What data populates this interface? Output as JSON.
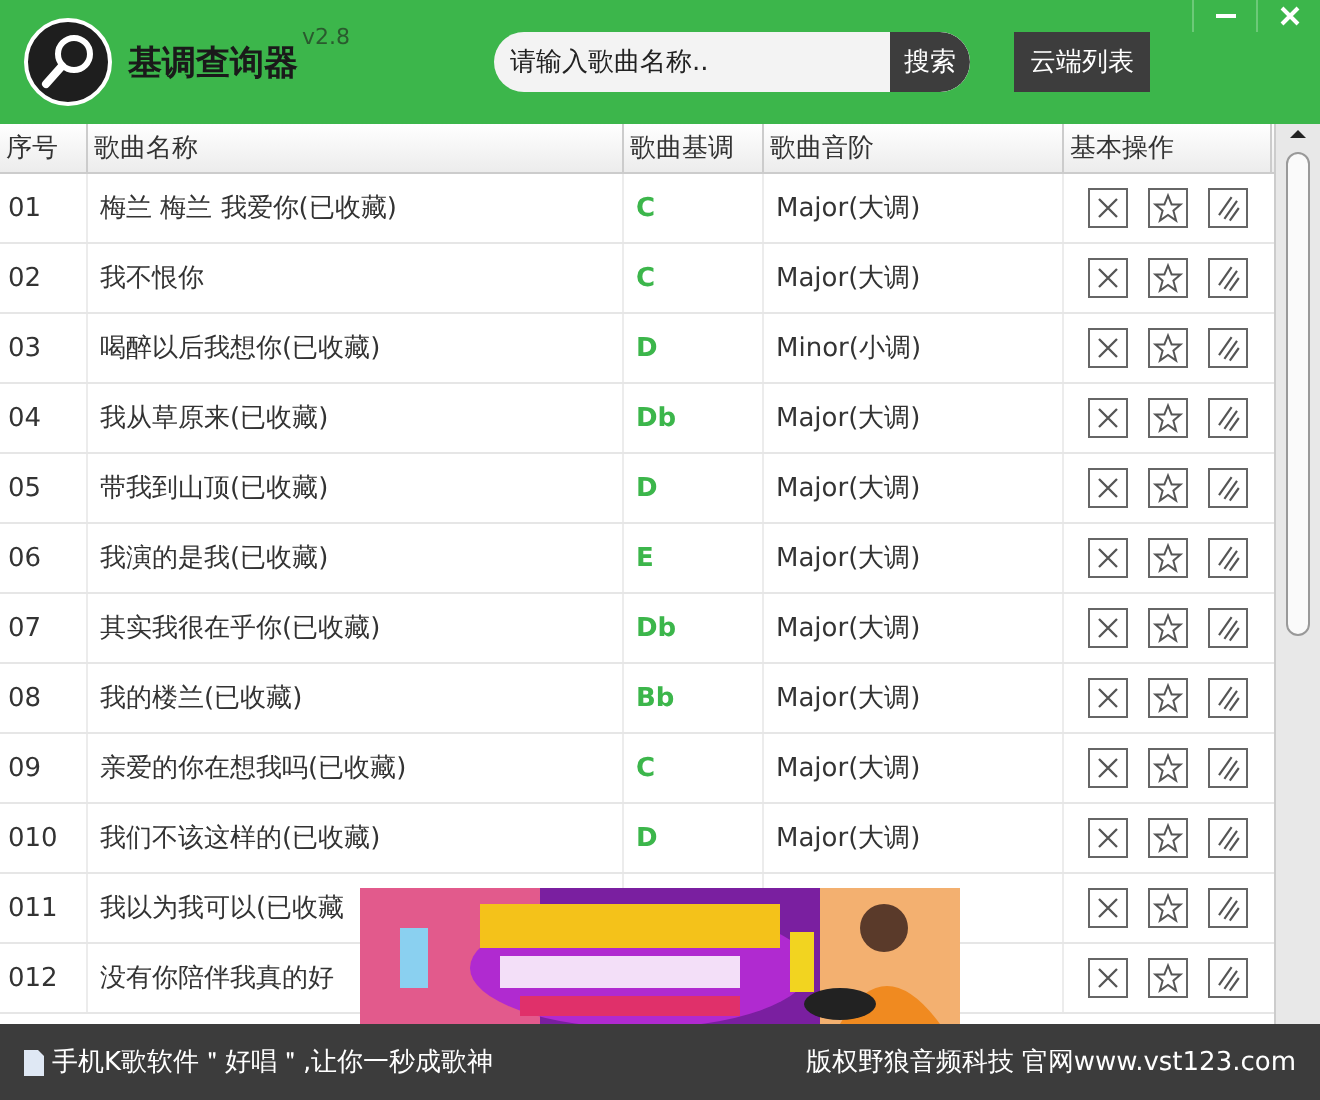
{
  "app": {
    "title": "基调查询器",
    "version": "v2.8"
  },
  "search": {
    "placeholder": "请输入歌曲名称..",
    "button": "搜索"
  },
  "cloud_button": "云端列表",
  "table": {
    "columns": [
      "序号",
      "歌曲名称",
      "歌曲基调",
      "歌曲音阶",
      "基本操作"
    ],
    "rows": [
      {
        "no": "01",
        "name": "梅兰 梅兰 我爱你(已收藏)",
        "key": "C",
        "scale": "Major(大调)"
      },
      {
        "no": "02",
        "name": "我不恨你",
        "key": "C",
        "scale": "Major(大调)"
      },
      {
        "no": "03",
        "name": "喝醉以后我想你(已收藏)",
        "key": "D",
        "scale": "Minor(小调)"
      },
      {
        "no": "04",
        "name": "我从草原来(已收藏)",
        "key": "Db",
        "scale": "Major(大调)"
      },
      {
        "no": "05",
        "name": "带我到山顶(已收藏)",
        "key": "D",
        "scale": "Major(大调)"
      },
      {
        "no": "06",
        "name": "我演的是我(已收藏)",
        "key": "E",
        "scale": "Major(大调)"
      },
      {
        "no": "07",
        "name": "其实我很在乎你(已收藏)",
        "key": "Db",
        "scale": "Major(大调)"
      },
      {
        "no": "08",
        "name": "我的楼兰(已收藏)",
        "key": "Bb",
        "scale": "Major(大调)"
      },
      {
        "no": "09",
        "name": "亲爱的你在想我吗(已收藏)",
        "key": "C",
        "scale": "Major(大调)"
      },
      {
        "no": "010",
        "name": "我们不该这样的(已收藏)",
        "key": "D",
        "scale": "Major(大调)"
      },
      {
        "no": "011",
        "name": "我以为我可以(已收藏"
      },
      {
        "no": "012",
        "name": "没有你陪伴我真的好"
      }
    ]
  },
  "footer": {
    "promo": "手机K歌软件＂好唱＂,让你一秒成歌神",
    "copyright": "版权野狼音频科技  官网www.vst123.com"
  }
}
